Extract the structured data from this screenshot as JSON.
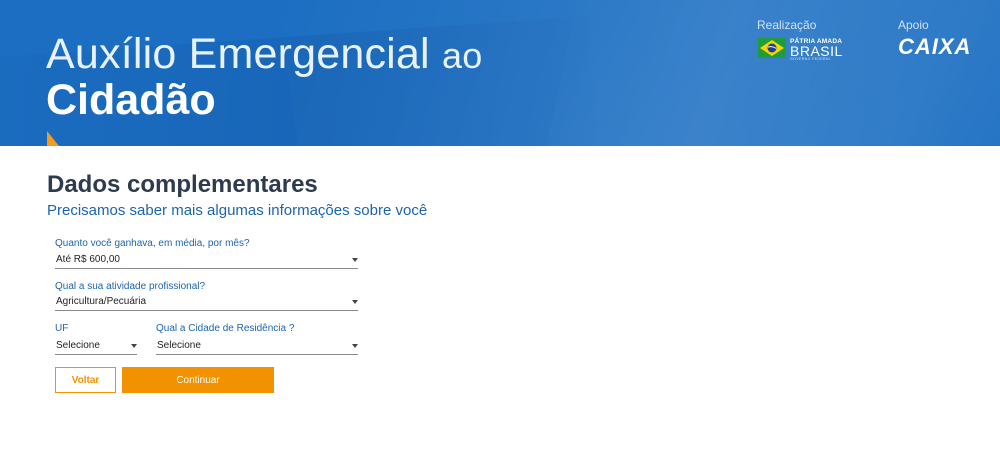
{
  "header": {
    "title_line1": "Auxílio Emergencial",
    "title_line1_suffix": "ao",
    "title_line2": "Cidadão",
    "realizacao_label": "Realização",
    "apoio_label": "Apoio",
    "gov_logo": {
      "line1": "PÁTRIA AMADA",
      "line2": "BRASIL",
      "line3": "GOVERNO FEDERAL"
    },
    "caixa_logo": "CAIXA",
    "colors": {
      "background": "#1b6ec2",
      "accent": "#f59a1b"
    }
  },
  "form": {
    "title": "Dados complementares",
    "subtitle": "Precisamos saber mais algumas informações sobre você",
    "fields": {
      "income": {
        "label": "Quanto você ganhava, em média, por mês?",
        "value": "Até R$ 600,00"
      },
      "occupation": {
        "label": "Qual a sua atividade profissional?",
        "value": "Agricultura/Pecuária"
      },
      "uf": {
        "label": "UF",
        "value": "Selecione"
      },
      "city": {
        "label": "Qual a Cidade de Residência ?",
        "value": "Selecione"
      }
    },
    "buttons": {
      "back": "Voltar",
      "continue": "Continuar"
    },
    "colors": {
      "primary": "#f39200",
      "label": "#1c64b0",
      "title": "#2e3b4e"
    }
  }
}
